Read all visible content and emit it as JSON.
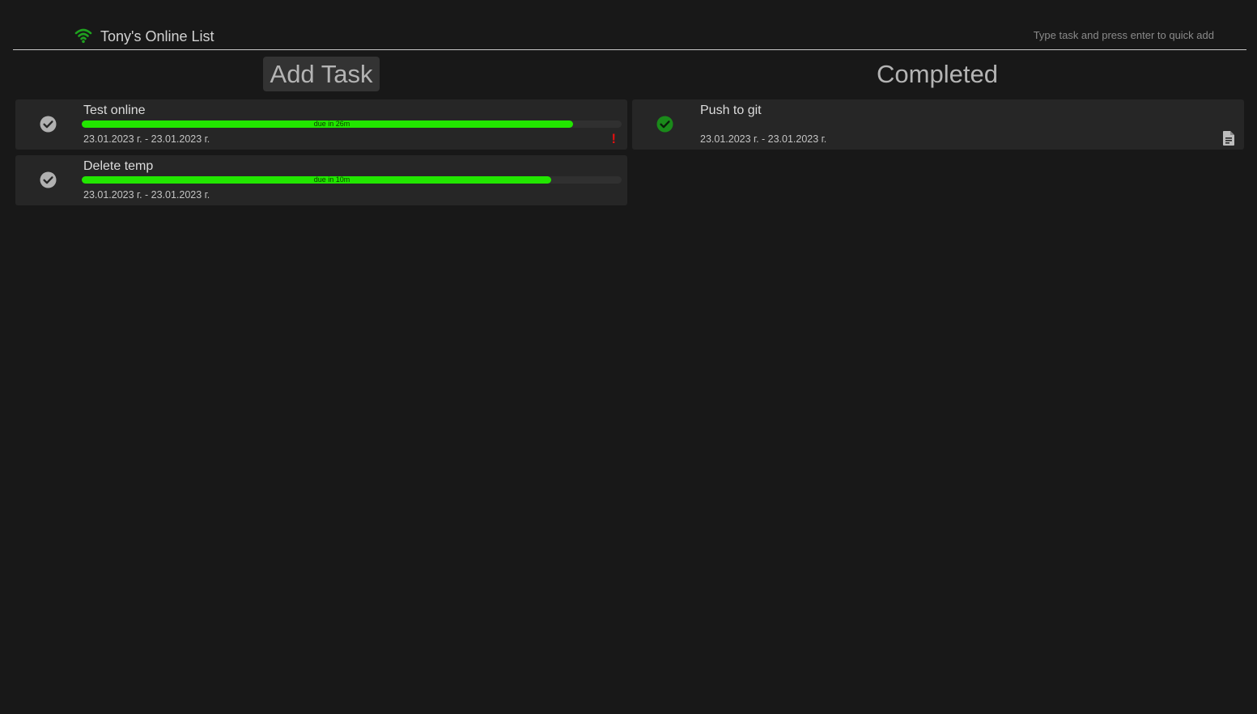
{
  "header": {
    "title": "Tony's Online List",
    "quick_add_placeholder": "Type task and press enter to quick add",
    "theme_icon": "moon-icon",
    "connection_icon": "wifi-icon",
    "theme_color": "#ffe600",
    "connection_color": "#1fa21f"
  },
  "columns": {
    "active_heading": "Add Task",
    "completed_heading": "Completed"
  },
  "active_tasks": [
    {
      "title": "Test online",
      "dates": "23.01.2023 г. - 23.01.2023 г.",
      "progress_label": "due in 26m",
      "progress_fraction": 0.91,
      "important": true,
      "important_mark": "!"
    },
    {
      "title": "Delete temp",
      "dates": "23.01.2023 г. - 23.01.2023 г.",
      "progress_label": "due in 10m",
      "progress_fraction": 0.87,
      "important": false
    }
  ],
  "completed_tasks": [
    {
      "title": "Push to git",
      "dates": "23.01.2023 г. - 23.01.2023 г.",
      "has_note": true,
      "note_icon": "document-icon"
    }
  ],
  "colors": {
    "background": "#181818",
    "card": "#262626",
    "progress": "#22e600",
    "important": "#e01010",
    "completed_check": "#1a8a1a",
    "pending_check": "#b0b0b0"
  }
}
